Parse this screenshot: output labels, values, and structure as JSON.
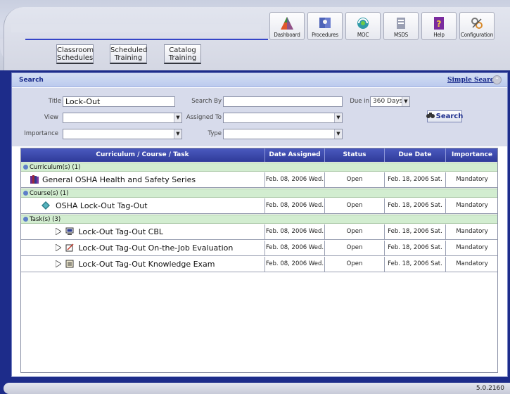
{
  "toolbar": [
    {
      "label": "Dashboard",
      "icon": "dashboard-icon"
    },
    {
      "label": "Procedures",
      "icon": "procedures-icon"
    },
    {
      "label": "MOC",
      "icon": "moc-icon"
    },
    {
      "label": "MSDS",
      "icon": "msds-icon"
    },
    {
      "label": "Help",
      "icon": "help-icon"
    },
    {
      "label": "Configuration",
      "icon": "configuration-icon"
    }
  ],
  "nav": {
    "classroom_l1": "Classroom",
    "classroom_l2": "Schedules",
    "scheduled_l1": "Scheduled",
    "scheduled_l2": "Training",
    "catalog_l1": "Catalog",
    "catalog_l2": "Training"
  },
  "search": {
    "header": "Search",
    "simple_search": "Simple Search",
    "title_label": "Title",
    "title_value": "Lock-Out",
    "search_by_label": "Search By",
    "search_by_value": "",
    "due_in_label": "Due in",
    "due_in_value": "360 Days",
    "view_label": "View",
    "view_value": "",
    "assigned_to_label": "Assigned To",
    "assigned_to_value": "",
    "importance_label": "Importance",
    "importance_value": "",
    "type_label": "Type",
    "type_value": "",
    "search_button": "Search"
  },
  "table": {
    "columns": [
      "Curriculum / Course / Task",
      "Date Assigned",
      "Status",
      "Due Date",
      "Importance"
    ],
    "groups": [
      {
        "label": "Curriculum(s) (1)",
        "rows": [
          {
            "name": "General OSHA Health and Safety Series",
            "date_assigned": "Feb. 08, 2006 Wed.",
            "status": "Open",
            "due_date": "Feb. 18, 2006 Sat.",
            "importance": "Mandatory",
            "icon": "curriculum-books-icon"
          }
        ]
      },
      {
        "label": "Course(s) (1)",
        "rows": [
          {
            "name": "OSHA  Lock-Out Tag-Out",
            "date_assigned": "Feb. 08, 2006 Wed.",
            "status": "Open",
            "due_date": "Feb. 18, 2006 Sat.",
            "importance": "Mandatory",
            "icon": "course-book-icon"
          }
        ]
      },
      {
        "label": "Task(s) (3)",
        "rows": [
          {
            "name": "Lock-Out Tag-Out CBL",
            "date_assigned": "Feb. 08, 2006 Wed.",
            "status": "Open",
            "due_date": "Feb. 18, 2006 Sat.",
            "importance": "Mandatory",
            "icon": "computer-task-icon"
          },
          {
            "name": "Lock-Out Tag-Out On-the-Job Evaluation",
            "date_assigned": "Feb. 08, 2006 Wed.",
            "status": "Open",
            "due_date": "Feb. 18, 2006 Sat.",
            "importance": "Mandatory",
            "icon": "evaluation-task-icon"
          },
          {
            "name": "Lock-Out Tag-Out Knowledge Exam",
            "date_assigned": "Feb. 08, 2006 Wed.",
            "status": "Open",
            "due_date": "Feb. 18, 2006 Sat.",
            "importance": "Mandatory",
            "icon": "exam-task-icon"
          }
        ]
      }
    ]
  },
  "footer": {
    "version": "5.0.2160"
  }
}
